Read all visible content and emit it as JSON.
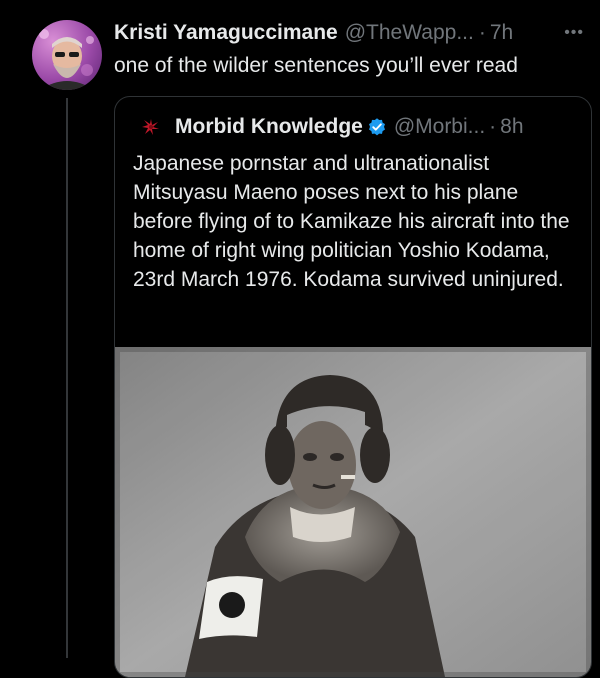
{
  "tweet": {
    "author_name": "Kristi Yamaguccimane",
    "handle": "@TheWapp...",
    "separator": "·",
    "time": "7h",
    "text": "one of the wilder sentences you’ll ever read",
    "more_icon": "more-horizontal-icon"
  },
  "quoted": {
    "author_name": "Morbid Knowledge",
    "verified": true,
    "handle": "@Morbi...",
    "separator": "·",
    "time": "8h",
    "text": "Japanese pornstar and ultranationalist Mitsuyasu Maeno poses next to his plane before flying of to Kamikaze his aircraft into the home of right wing politician Yoshio Kodama, 23rd March 1976. Kodama survived uninjured.",
    "avatar_icon": "morbid-knowledge-logo-icon"
  },
  "colors": {
    "background": "#000000",
    "text_primary": "#e7e9ea",
    "text_secondary": "#71767b",
    "border": "#2f3336",
    "verified": "#1d9bf0"
  }
}
